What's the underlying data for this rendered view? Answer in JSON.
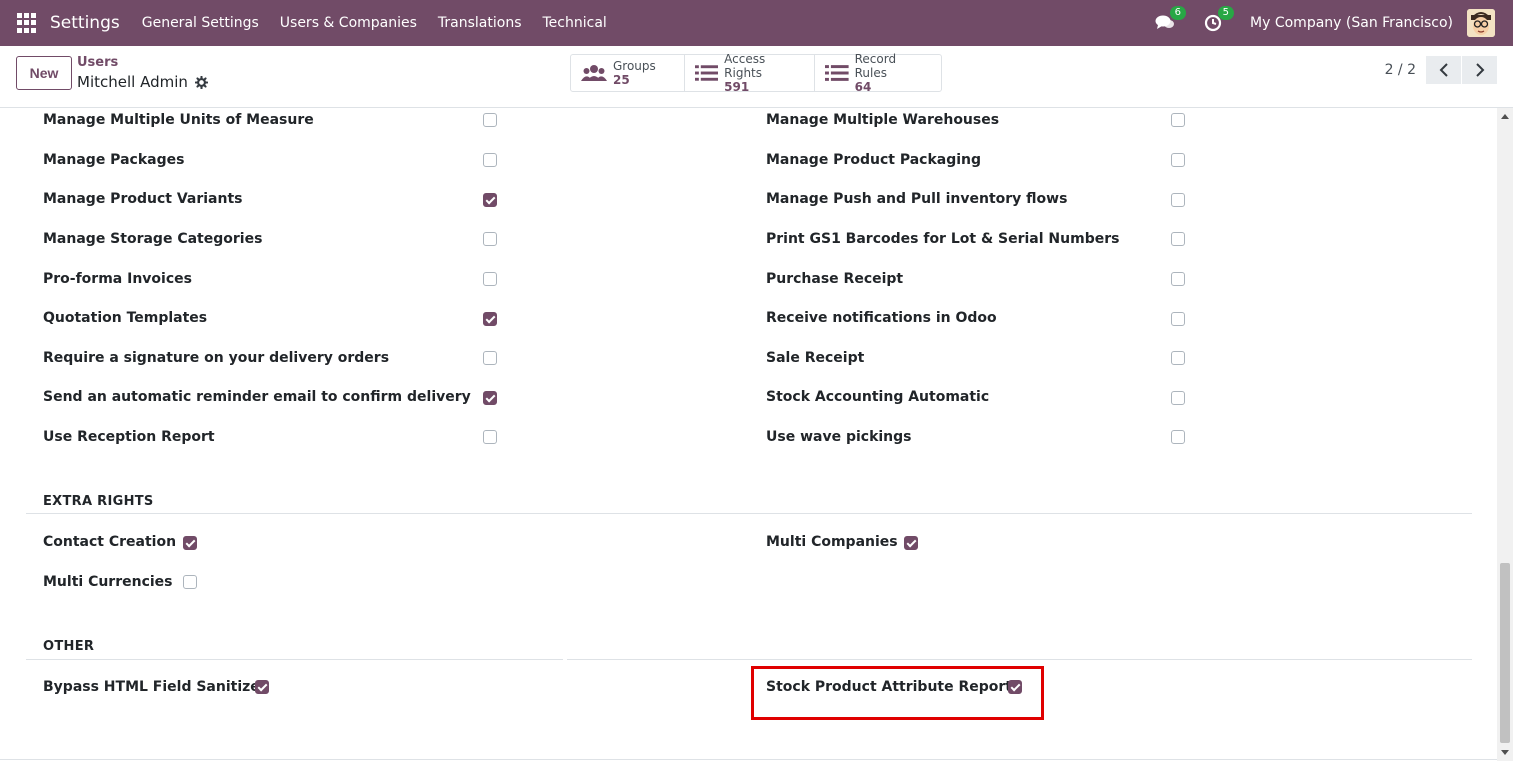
{
  "navbar": {
    "app_name": "Settings",
    "menus": [
      "General Settings",
      "Users & Companies",
      "Translations",
      "Technical"
    ],
    "messages_count": "6",
    "activities_count": "5",
    "company": "My Company (San Francisco)"
  },
  "control": {
    "new_label": "New",
    "breadcrumb": "Users",
    "record_name": "Mitchell Admin",
    "smart_buttons": [
      {
        "label": "Groups",
        "count": "25"
      },
      {
        "label": "Access Rights",
        "count": "591"
      },
      {
        "label": "Record Rules",
        "count": "64"
      }
    ],
    "pager": "2 / 2"
  },
  "technical_rows": [
    {
      "left": {
        "label": "Manage Multiple Units of Measure",
        "checked": false
      },
      "right": {
        "label": "Manage Multiple Warehouses",
        "checked": false
      }
    },
    {
      "left": {
        "label": "Manage Packages",
        "checked": false
      },
      "right": {
        "label": "Manage Product Packaging",
        "checked": false
      }
    },
    {
      "left": {
        "label": "Manage Product Variants",
        "checked": true
      },
      "right": {
        "label": "Manage Push and Pull inventory flows",
        "checked": false
      }
    },
    {
      "left": {
        "label": "Manage Storage Categories",
        "checked": false
      },
      "right": {
        "label": "Print GS1 Barcodes for Lot & Serial Numbers",
        "checked": false
      }
    },
    {
      "left": {
        "label": "Pro-forma Invoices",
        "checked": false
      },
      "right": {
        "label": "Purchase Receipt",
        "checked": false
      }
    },
    {
      "left": {
        "label": "Quotation Templates",
        "checked": true
      },
      "right": {
        "label": "Receive notifications in Odoo",
        "checked": false
      }
    },
    {
      "left": {
        "label": "Require a signature on your delivery orders",
        "checked": false
      },
      "right": {
        "label": "Sale Receipt",
        "checked": false
      }
    },
    {
      "left": {
        "label": "Send an automatic reminder email to confirm delivery",
        "checked": true
      },
      "right": {
        "label": "Stock Accounting Automatic",
        "checked": false
      }
    },
    {
      "left": {
        "label": "Use Reception Report",
        "checked": false
      },
      "right": {
        "label": "Use wave pickings",
        "checked": false
      }
    }
  ],
  "extra_rights": {
    "title": "EXTRA RIGHTS",
    "contact_creation": {
      "label": "Contact Creation",
      "checked": true
    },
    "multi_companies": {
      "label": "Multi Companies",
      "checked": true
    },
    "multi_currencies": {
      "label": "Multi Currencies",
      "checked": false
    }
  },
  "other": {
    "title": "OTHER",
    "bypass_html": {
      "label": "Bypass HTML Field Sanitize",
      "checked": true
    },
    "stock_product_attribute": {
      "label": "Stock Product Attribute Report",
      "checked": true
    }
  },
  "colors": {
    "brand": "#714B67",
    "badge": "#28a745",
    "highlight": "#e00000"
  }
}
